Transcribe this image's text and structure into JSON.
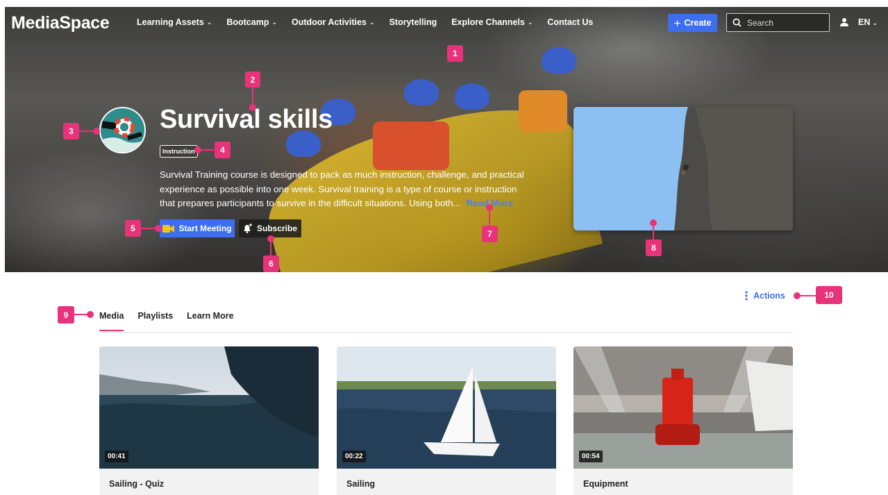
{
  "app": {
    "logo": "MediaSpace",
    "nav": [
      {
        "label": "Learning Assets",
        "dropdown": true
      },
      {
        "label": "Bootcamp",
        "dropdown": true
      },
      {
        "label": "Outdoor Activities",
        "dropdown": true
      },
      {
        "label": "Storytelling",
        "dropdown": false
      },
      {
        "label": "Explore Channels",
        "dropdown": true
      },
      {
        "label": "Contact Us",
        "dropdown": false
      }
    ],
    "create_label": "Create",
    "search_placeholder": "Search",
    "language": "EN",
    "accent_color": "#3d6ef0",
    "marker_color": "#e8337a"
  },
  "channel": {
    "title": "Survival skills",
    "tag": "Instruction",
    "description": "Survival Training course is designed to pack as much instruction, challenge, and practical experience as possible into one week. Survival training is a type of course or instruction that prepares participants to survive in the difficult situations. Using both...",
    "read_more": "Read More",
    "start_meeting_label": "Start Meeting",
    "subscribe_label": "Subscribe"
  },
  "markers": [
    "1",
    "2",
    "3",
    "4",
    "5",
    "6",
    "7",
    "8",
    "9",
    "10"
  ],
  "tabs": [
    {
      "label": "Media",
      "active": true
    },
    {
      "label": "Playlists",
      "active": false
    },
    {
      "label": "Learn More",
      "active": false
    }
  ],
  "actions_label": "Actions",
  "media": [
    {
      "title": "Sailing - Quiz",
      "duration": "00:41"
    },
    {
      "title": "Sailing",
      "duration": "00:22"
    },
    {
      "title": "Equipment",
      "duration": "00:54"
    }
  ]
}
